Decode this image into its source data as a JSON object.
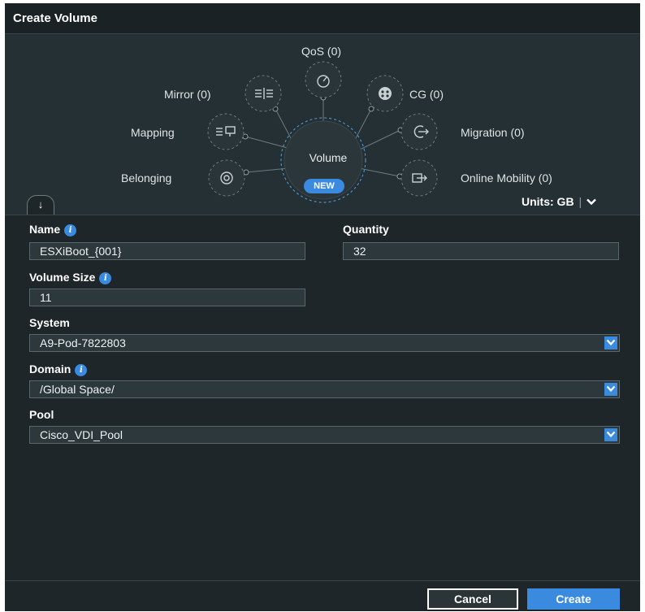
{
  "dialog": {
    "title": "Create Volume"
  },
  "diagram": {
    "hub_label": "Volume",
    "hub_badge": "NEW",
    "nodes": {
      "qos": "QoS (0)",
      "mirror": "Mirror (0)",
      "cg": "CG (0)",
      "mapping": "Mapping",
      "migration": "Migration (0)",
      "belonging": "Belonging",
      "online_mobility": "Online Mobility (0)"
    }
  },
  "toolbar": {
    "collapse_glyph": "↓",
    "units_label": "Units: GB",
    "units_separator": "|"
  },
  "form": {
    "name": {
      "label": "Name",
      "value": "ESXiBoot_{001}"
    },
    "quantity": {
      "label": "Quantity",
      "value": "32"
    },
    "volume_size": {
      "label": "Volume Size",
      "value": "11"
    },
    "system": {
      "label": "System",
      "value": "A9-Pod-7822803"
    },
    "domain": {
      "label": "Domain",
      "value": "/Global Space/"
    },
    "pool": {
      "label": "Pool",
      "value": "Cisco_VDI_Pool"
    },
    "info_glyph": "i"
  },
  "footer": {
    "cancel_label": "Cancel",
    "create_label": "Create"
  },
  "colors": {
    "accent": "#3a8be0",
    "background": "#1e2629",
    "diagram_background": "#253034"
  }
}
